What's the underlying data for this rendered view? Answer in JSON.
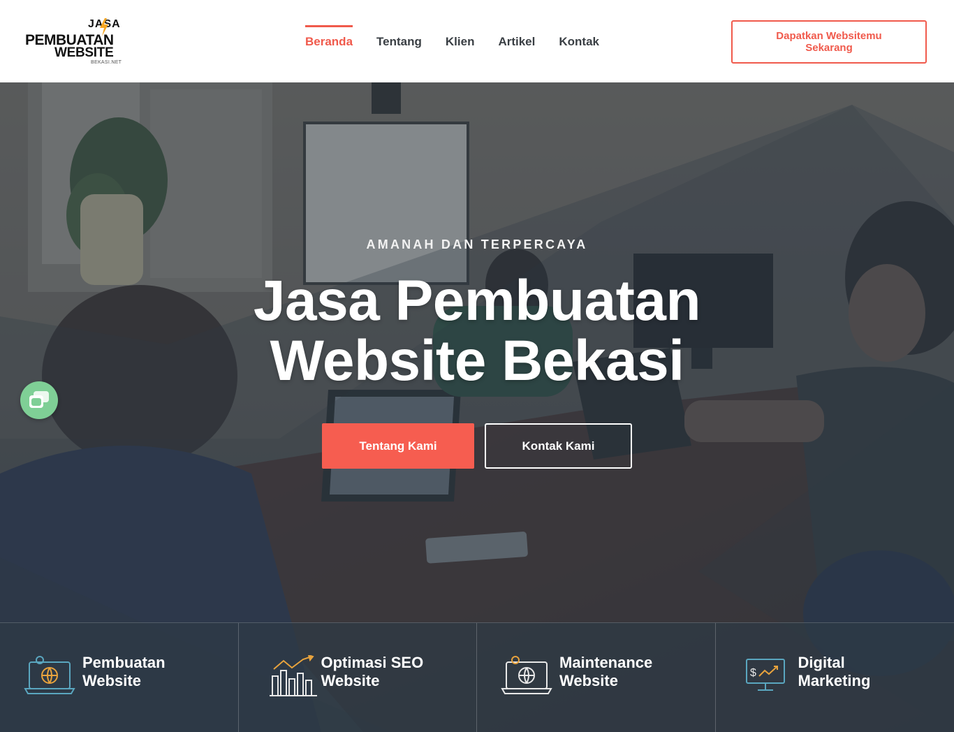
{
  "header": {
    "logo": {
      "line1": "JASA",
      "line2": "PEMBUATAN",
      "line3": "WEBSITE",
      "domain": "BEKASI.NET"
    },
    "nav": [
      {
        "label": "Beranda",
        "active": true
      },
      {
        "label": "Tentang",
        "active": false
      },
      {
        "label": "Klien",
        "active": false
      },
      {
        "label": "Artikel",
        "active": false
      },
      {
        "label": "Kontak",
        "active": false
      }
    ],
    "cta_label": "Dapatkan Websitemu Sekarang"
  },
  "hero": {
    "eyebrow": "AMANAH DAN TERPERCAYA",
    "title_line1": "Jasa Pembuatan",
    "title_line2": "Website Bekasi",
    "primary_button": "Tentang Kami",
    "secondary_button": "Kontak Kami",
    "chat_icon": "chat-icon"
  },
  "services": [
    {
      "line1": "Pembuatan",
      "line2": "Website",
      "icon": "laptop-globe-icon"
    },
    {
      "line1": "Optimasi SEO",
      "line2": "Website",
      "icon": "growth-chart-icon"
    },
    {
      "line1": "Maintenance",
      "line2": "Website",
      "icon": "laptop-globe-icon"
    },
    {
      "line1": "Digital",
      "line2": "Marketing",
      "icon": "monitor-dollar-icon"
    }
  ],
  "colors": {
    "accent": "#f05a4c",
    "button": "#f65d50",
    "chat": "#7fcf96",
    "overlay": "#2e3a45"
  }
}
